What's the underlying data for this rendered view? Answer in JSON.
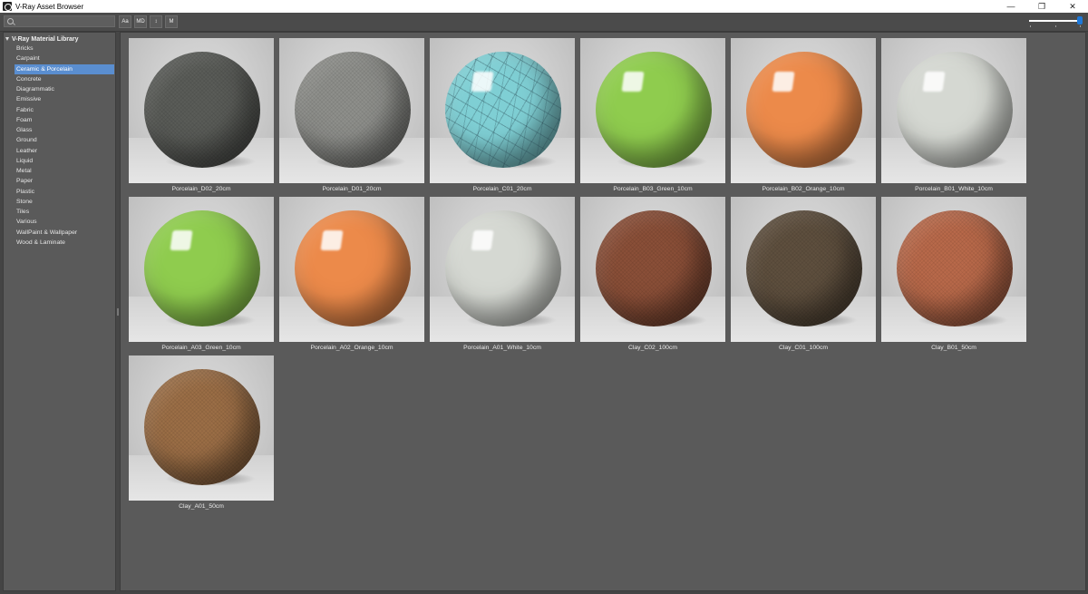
{
  "window": {
    "title": "V-Ray Asset Browser",
    "controls": {
      "minimize": "—",
      "restore": "❐",
      "close": "✕"
    }
  },
  "toolbar": {
    "search": {
      "value": "",
      "placeholder": ""
    },
    "buttons": [
      "Aa",
      "MD",
      "↕",
      "M"
    ],
    "zoom_slider": {
      "value_fraction": 0.95
    }
  },
  "sidebar": {
    "root_label": "V-Ray Material Library",
    "categories": [
      "Bricks",
      "Carpaint",
      "Ceramic & Porcelain",
      "Concrete",
      "Diagrammatic",
      "Emissive",
      "Fabric",
      "Foam",
      "Glass",
      "Ground",
      "Leather",
      "Liquid",
      "Metal",
      "Paper",
      "Plastic",
      "Stone",
      "Tiles",
      "Various",
      "WallPaint & Wallpaper",
      "Wood & Laminate"
    ],
    "selected_index": 2
  },
  "materials": [
    {
      "name": "Porcelain_D02_20cm",
      "color": "#5a5c58",
      "finish": "rough"
    },
    {
      "name": "Porcelain_D01_20cm",
      "color": "#8e8f8b",
      "finish": "rough"
    },
    {
      "name": "Porcelain_C01_20cm",
      "color": "#7fcfd4",
      "finish": "cracked"
    },
    {
      "name": "Porcelain_B03_Green_10cm",
      "color": "#8fcc4e",
      "finish": "glossy"
    },
    {
      "name": "Porcelain_B02_Orange_10cm",
      "color": "#ec8a4a",
      "finish": "glossy"
    },
    {
      "name": "Porcelain_B01_White_10cm",
      "color": "#d5d8d2",
      "finish": "glossy"
    },
    {
      "name": "Porcelain_A03_Green_10cm",
      "color": "#8fcc4e",
      "finish": "glossy"
    },
    {
      "name": "Porcelain_A02_Orange_10cm",
      "color": "#ec8a4a",
      "finish": "glossy"
    },
    {
      "name": "Porcelain_A01_White_10cm",
      "color": "#d5d8d2",
      "finish": "glossy"
    },
    {
      "name": "Clay_C02_100cm",
      "color": "#8a4f38",
      "finish": "rough"
    },
    {
      "name": "Clay_C01_100cm",
      "color": "#5e4f3e",
      "finish": "rough"
    },
    {
      "name": "Clay_B01_50cm",
      "color": "#b8694a",
      "finish": "rough"
    },
    {
      "name": "Clay_A01_50cm",
      "color": "#9b6e46",
      "finish": "rough"
    }
  ]
}
